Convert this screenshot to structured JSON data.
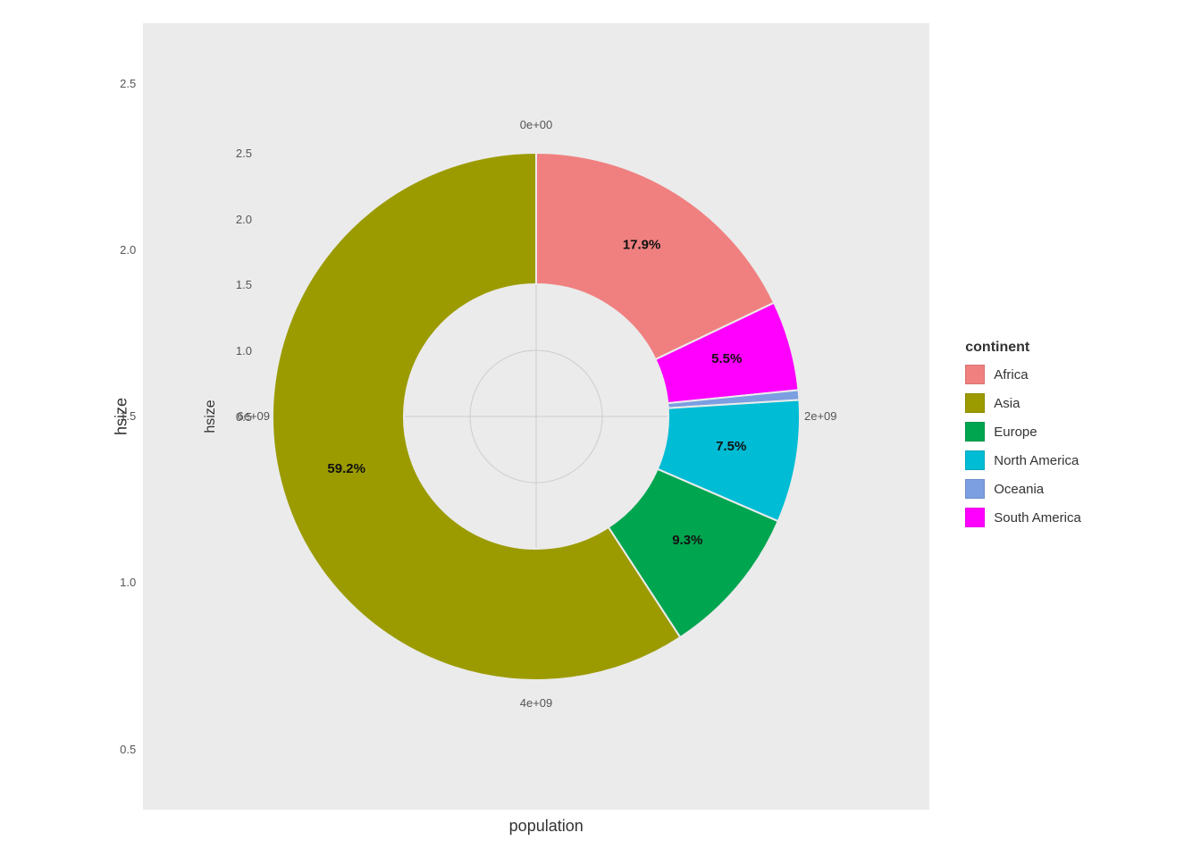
{
  "chart": {
    "title": "",
    "x_axis_label": "population",
    "y_axis_label": "hsize",
    "x_ticks": [
      "2e+09",
      "4e+09",
      "0e+00",
      "6e+09"
    ],
    "y_ticks": [
      "2.5",
      "2.0",
      "1.5",
      "1.0",
      "0.5"
    ],
    "polar_labels": [
      "0e+00",
      "2e+09",
      "4e+09",
      "6e+09"
    ],
    "legend_title": "continent",
    "segments": [
      {
        "label": "Africa",
        "percent": "17.9%",
        "color": "#F08080",
        "value": 0.179
      },
      {
        "label": "Asia",
        "percent": "59.2%",
        "color": "#9B9B00",
        "value": 0.592
      },
      {
        "label": "Europe",
        "percent": "9.3%",
        "color": "#00A550",
        "value": 0.093
      },
      {
        "label": "North America",
        "percent": "7.5%",
        "color": "#00BCD4",
        "value": 0.075
      },
      {
        "label": "Oceania",
        "percent": "0.6%",
        "color": "#7B9FE0",
        "value": 0.006
      },
      {
        "label": "South America",
        "percent": "5.5%",
        "color": "#FF00FF",
        "value": 0.055
      }
    ]
  }
}
